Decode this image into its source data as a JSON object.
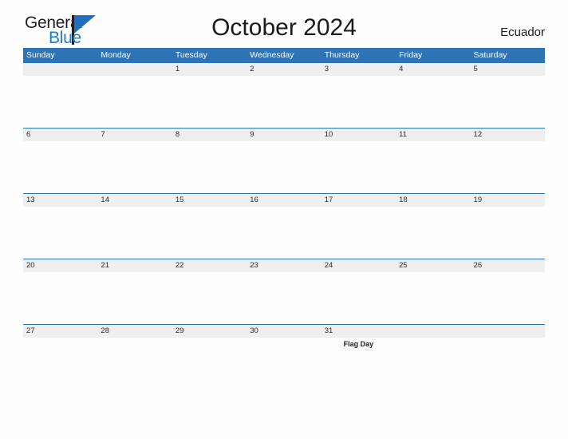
{
  "brand": {
    "word_one": "General",
    "word_two": "Blue",
    "flag_icon": "triangle-flag-icon"
  },
  "header": {
    "title": "October 2024",
    "country": "Ecuador"
  },
  "colors": {
    "header_blue": "#2e74b5",
    "band_gray": "#efefef",
    "page_bg": "#fdfdfd",
    "brand_blue": "#1f7ac9",
    "text_dark": "#1a1a1a"
  },
  "calendar": {
    "weekdays": [
      "Sunday",
      "Monday",
      "Tuesday",
      "Wednesday",
      "Thursday",
      "Friday",
      "Saturday"
    ],
    "weeks": [
      {
        "days": [
          {
            "num": "",
            "event": ""
          },
          {
            "num": "",
            "event": ""
          },
          {
            "num": "1",
            "event": ""
          },
          {
            "num": "2",
            "event": ""
          },
          {
            "num": "3",
            "event": ""
          },
          {
            "num": "4",
            "event": ""
          },
          {
            "num": "5",
            "event": ""
          }
        ]
      },
      {
        "days": [
          {
            "num": "6",
            "event": ""
          },
          {
            "num": "7",
            "event": ""
          },
          {
            "num": "8",
            "event": ""
          },
          {
            "num": "9",
            "event": ""
          },
          {
            "num": "10",
            "event": ""
          },
          {
            "num": "11",
            "event": ""
          },
          {
            "num": "12",
            "event": ""
          }
        ]
      },
      {
        "days": [
          {
            "num": "13",
            "event": ""
          },
          {
            "num": "14",
            "event": ""
          },
          {
            "num": "15",
            "event": ""
          },
          {
            "num": "16",
            "event": ""
          },
          {
            "num": "17",
            "event": ""
          },
          {
            "num": "18",
            "event": ""
          },
          {
            "num": "19",
            "event": ""
          }
        ]
      },
      {
        "days": [
          {
            "num": "20",
            "event": ""
          },
          {
            "num": "21",
            "event": ""
          },
          {
            "num": "22",
            "event": ""
          },
          {
            "num": "23",
            "event": ""
          },
          {
            "num": "24",
            "event": ""
          },
          {
            "num": "25",
            "event": ""
          },
          {
            "num": "26",
            "event": ""
          }
        ]
      },
      {
        "days": [
          {
            "num": "27",
            "event": ""
          },
          {
            "num": "28",
            "event": ""
          },
          {
            "num": "29",
            "event": ""
          },
          {
            "num": "30",
            "event": ""
          },
          {
            "num": "31",
            "event": "Flag Day"
          },
          {
            "num": "",
            "event": ""
          },
          {
            "num": "",
            "event": ""
          }
        ]
      }
    ]
  }
}
